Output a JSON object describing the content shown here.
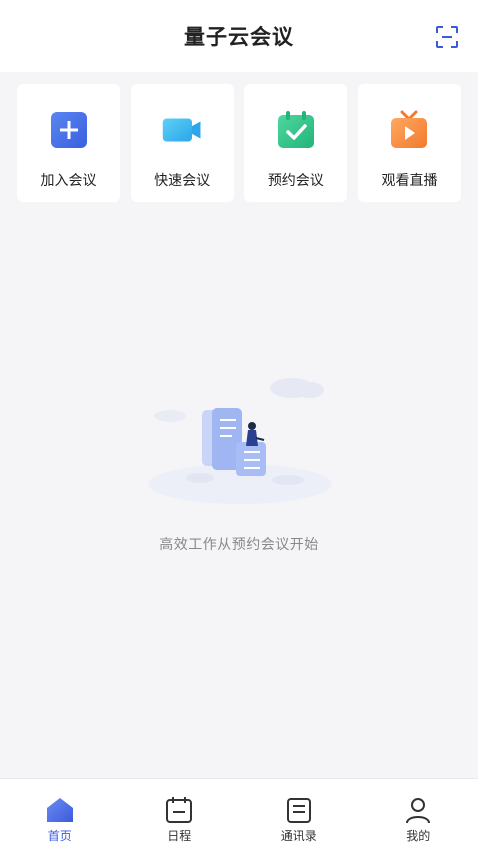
{
  "header": {
    "title": "量子云会议",
    "scan_icon": "scan-icon"
  },
  "actions": [
    {
      "label": "加入会议",
      "icon": "plus-square-icon",
      "color": "#4a72e8"
    },
    {
      "label": "快速会议",
      "icon": "video-camera-icon",
      "color": "#3fb6f0"
    },
    {
      "label": "预约会议",
      "icon": "calendar-check-icon",
      "color": "#2ec48a"
    },
    {
      "label": "观看直播",
      "icon": "tv-play-icon",
      "color": "#f58a3a"
    }
  ],
  "empty_state": {
    "message": "高效工作从预约会议开始",
    "illustration": "person-reading-documents-illustration"
  },
  "tabbar": {
    "tabs": [
      {
        "label": "首页",
        "icon": "home-icon",
        "active": true
      },
      {
        "label": "日程",
        "icon": "calendar-icon",
        "active": false
      },
      {
        "label": "通讯录",
        "icon": "contacts-icon",
        "active": false
      },
      {
        "label": "我的",
        "icon": "user-icon",
        "active": false
      }
    ]
  },
  "colors": {
    "accent": "#3b5bdb",
    "background": "#f5f5f7"
  }
}
